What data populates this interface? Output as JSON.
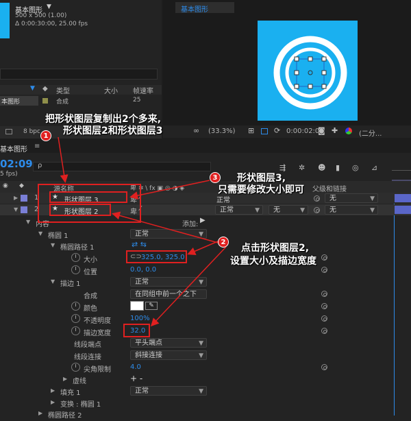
{
  "project": {
    "comp_name": "基本图形",
    "comp_dims": "500 x 500 (1.00)",
    "comp_duration": "Δ 0:00:30:00, 25.00 fps",
    "col_type": "类型",
    "col_size": "大小",
    "col_fps": "帧速率",
    "item_name": "本图形",
    "item_type": "合成",
    "item_fps": "25",
    "bpc": "8 bpc"
  },
  "viewer": {
    "tab_label": "基本图形",
    "zoom": "(33.3%)",
    "time": "0:00:02:09",
    "view_mode": "(二分..."
  },
  "timeline": {
    "tab_label": "基本图形",
    "menu_glyph": "≡",
    "current_time": "02:09",
    "fps_note": "5 fps)",
    "search_glyph": "ρ",
    "col_source_name": "源名称",
    "col_parent": "父级和链接",
    "layers": [
      {
        "num": "1",
        "name": "形状图层 3",
        "mode": "正常",
        "trkmat": "",
        "parent": "无"
      },
      {
        "num": "2",
        "name": "形状图层 2",
        "mode": "正常",
        "trkmat": "无",
        "parent": "无"
      }
    ],
    "contents_label": "内容",
    "add_label": "添加:",
    "props": {
      "ellipse": "椭圆 1",
      "ellipse_mode": "正常",
      "ellipse_path": "椭圆路径 1",
      "size": "大小",
      "size_value": "325.0, 325.0",
      "position": "位置",
      "position_value": "0.0, 0.0",
      "stroke": "描边 1",
      "stroke_mode": "正常",
      "composite": "合成",
      "composite_value": "在同组中前一个之下",
      "color": "颜色",
      "opacity": "不透明度",
      "opacity_value": "100%",
      "stroke_width": "描边宽度",
      "stroke_width_value": "32.0",
      "line_cap": "线段端点",
      "line_cap_value": "平头端点",
      "line_join": "线段连接",
      "line_join_value": "斜接连接",
      "miter_limit": "尖角限制",
      "miter_limit_value": "4.0",
      "dashes": "虚线",
      "dashes_value": "+ -",
      "fill": "填充 1",
      "fill_mode": "正常",
      "transform": "变换 : 椭圆 1",
      "bottom_row": "椭圆路径 2"
    }
  },
  "annotations": {
    "note1": "把形状图层复制出2个多来,",
    "note1b": "形状图层2和形状图层3",
    "note2": "点击形状图层2,",
    "note2b": "设置大小及描边宽度",
    "note3": "形状图层3,",
    "note3b": "只需要修改大小即可",
    "badge1": "1",
    "badge2": "2",
    "badge3": "3"
  },
  "colors": {
    "accent": "#2d8ceb",
    "annotation_red": "#e02020",
    "comp_blue": "#1ab0f0",
    "layer_label": "#7a7fd6"
  }
}
